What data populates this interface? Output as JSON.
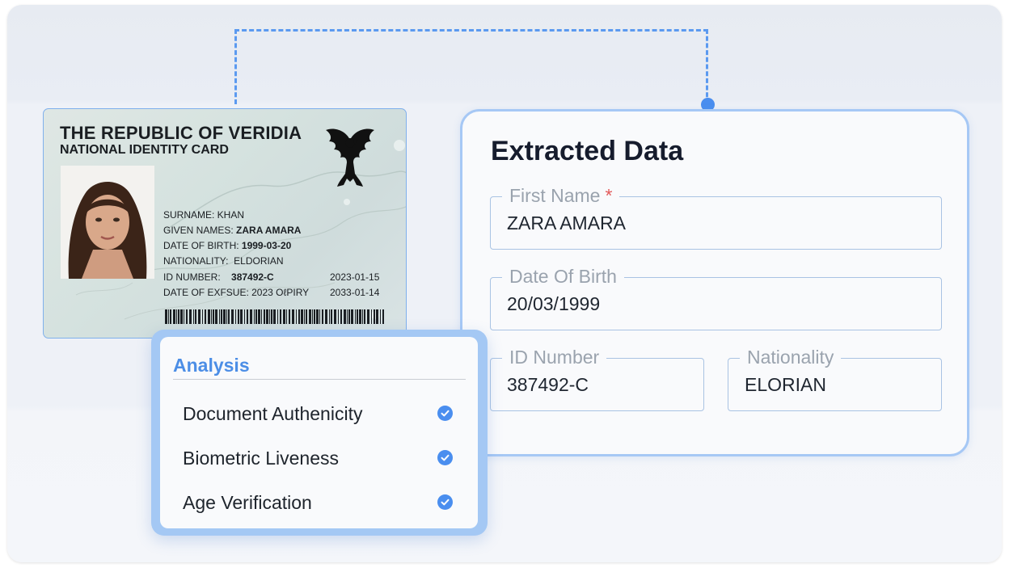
{
  "id_card": {
    "title": "THE REPUBLIC OF VERIDIA",
    "subtitle": "NATIONAL IDENTITY CARD",
    "surname": "SURNAME: KHAN",
    "given_names_label": "GIVEN NAMES:",
    "given_names_value": "ZARA AMARA",
    "dob_label": "DATE OF BIRTH:",
    "dob_value": "1999-03-20",
    "nationality_label": "NATIONALITY:",
    "nationality_value": "ELDORIAN",
    "id_label": "ID NUMBER:",
    "id_value": "387492-C",
    "issue_date": "2023-01-15",
    "expiry_label": "DATE OF EXFSUE: 2023 OℓPIRY",
    "expiry_date": "2033-01-14"
  },
  "extracted": {
    "title": "Extracted Data",
    "fields": [
      {
        "label": "First Name",
        "required_mark": "*",
        "value": "ZARA AMARA"
      },
      {
        "label": "Date Of Birth",
        "value": "20/03/1999"
      },
      {
        "label": "ID Number",
        "value": "387492-C"
      },
      {
        "label": "Nationality",
        "value": "ELORIAN"
      }
    ]
  },
  "analysis": {
    "title": "Analysis",
    "items": [
      {
        "label": "Document Authenicity",
        "status": "verified"
      },
      {
        "label": "Biometric Liveness",
        "status": "verified"
      },
      {
        "label": "Age Verification",
        "status": "verified"
      }
    ]
  },
  "colors": {
    "accent": "#4a8eef",
    "panel_border": "#a6c8f5",
    "required": "#e25a5a"
  }
}
